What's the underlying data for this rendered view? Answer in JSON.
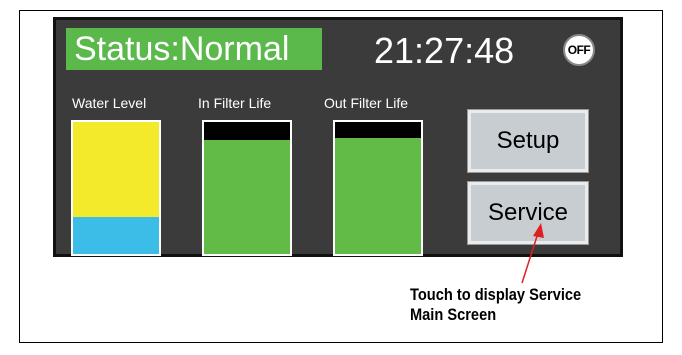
{
  "panel": {
    "status_text": "Status:Normal",
    "status_color": "#5bb84a",
    "clock": "21:27:48",
    "off_label": "OFF"
  },
  "gauges": [
    {
      "label": "Water Level",
      "level_top_fraction": 0.0,
      "fill_color": "#f4ea2c",
      "secondary_fraction": 0.28,
      "secondary_color": "#3bbde8"
    },
    {
      "label": "In Filter Life",
      "remaining_fraction": 0.86,
      "fill_color": "#63bb47"
    },
    {
      "label": "Out Filter Life",
      "remaining_fraction": 0.88,
      "fill_color": "#63bb47"
    }
  ],
  "buttons": {
    "setup": "Setup",
    "service": "Service"
  },
  "annotation": {
    "line1": "Touch to display Service",
    "line2": "Main Screen",
    "arrow_color": "#e02020"
  }
}
